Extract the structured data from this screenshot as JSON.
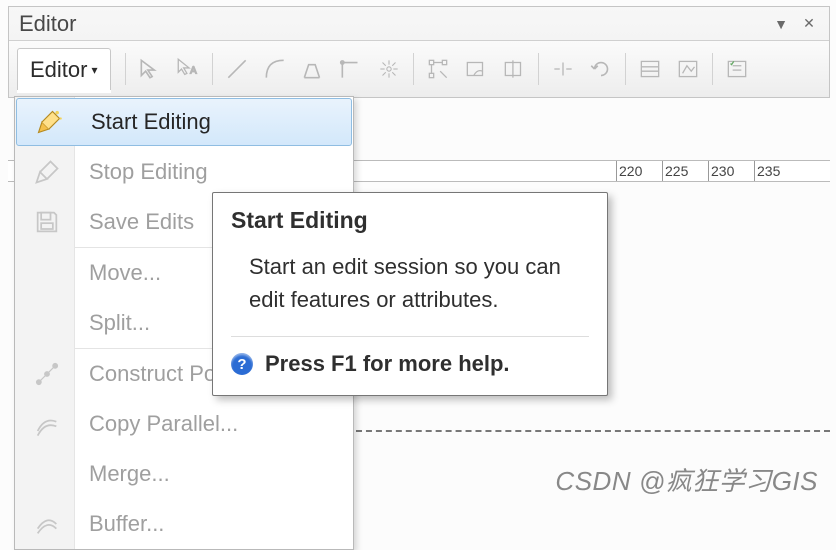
{
  "panel": {
    "title": "Editor"
  },
  "toolbar": {
    "editor_label": "Editor"
  },
  "menu": {
    "items": [
      {
        "label": "Start Editing",
        "enabled": true,
        "hover": true,
        "icon": "pencil-stars-icon"
      },
      {
        "label": "Stop Editing",
        "enabled": false,
        "icon": "pencil-disabled-icon"
      },
      {
        "label": "Save Edits",
        "enabled": false,
        "icon": "save-icon"
      },
      {
        "label": "Move...",
        "enabled": false
      },
      {
        "label": "Split...",
        "enabled": false
      },
      {
        "label": "Construct Poin",
        "enabled": false,
        "icon": "construct-points-icon"
      },
      {
        "label": "Copy Parallel...",
        "enabled": false,
        "icon": "copy-parallel-icon"
      },
      {
        "label": "Merge...",
        "enabled": false
      },
      {
        "label": "Buffer...",
        "enabled": false,
        "icon": "buffer-icon"
      }
    ],
    "dividers_after": [
      2,
      4
    ]
  },
  "tooltip": {
    "title": "Start Editing",
    "body": "Start an edit session so you can edit features or attributes.",
    "help": "Press F1 for more help."
  },
  "ruler": {
    "ticks": [
      "220",
      "225",
      "230",
      "235"
    ]
  },
  "watermark": "CSDN @疯狂学习GIS"
}
